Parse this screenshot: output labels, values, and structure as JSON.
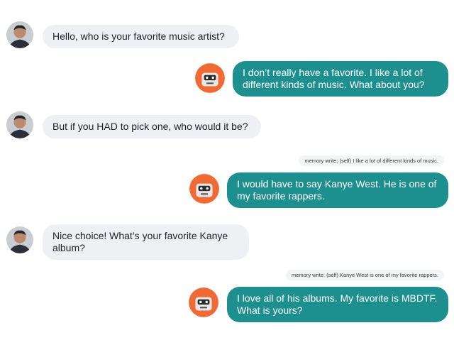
{
  "messages": [
    {
      "id": "m1",
      "sender": "user",
      "text": "Hello, who is your favorite music artist?"
    },
    {
      "id": "m2",
      "sender": "bot",
      "text": "I don’t really have a favorite. I like a lot of different kinds of music. What about you?"
    },
    {
      "id": "m3",
      "sender": "user",
      "text": "But if you HAD to pick one, who would it be?"
    },
    {
      "id": "m4",
      "sender": "bot",
      "memory": "memory write: (self) I like a lot of different kinds of music.",
      "text": "I would have to say Kanye West. He is one of my favorite rappers."
    },
    {
      "id": "m5",
      "sender": "user",
      "text": "Nice choice! What’s your favorite Kanye album?"
    },
    {
      "id": "m6",
      "sender": "bot",
      "memory": "memory write: (self) Kanye West is one of my favorite rappers.",
      "text": "I love all of his albums. My favorite is MBDTF. What is yours?"
    }
  ],
  "colors": {
    "bot_bubble": "#1d8f8e",
    "user_bubble": "#eef0f3",
    "bot_avatar": "#f06a35"
  },
  "icons": {
    "user_avatar": "person-avatar-icon",
    "bot_avatar": "robot-avatar-icon"
  }
}
